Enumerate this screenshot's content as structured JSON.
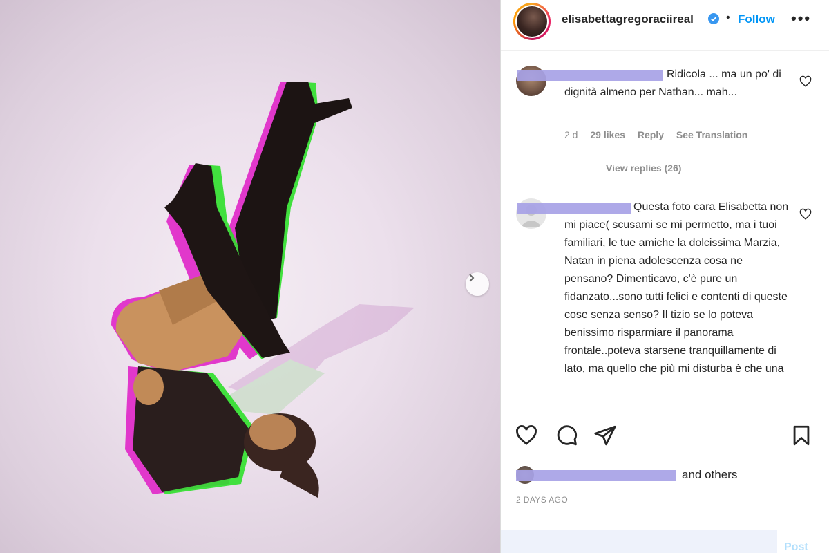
{
  "post": {
    "username": "elisabettagregoraciireal",
    "follow_label": "Follow",
    "more_label": "•••",
    "separator": "•"
  },
  "comments": [
    {
      "text": "Ridicola ... ma un po' di dignità almeno per Nathan... mah...",
      "age": "2 d",
      "likes": "29 likes",
      "reply_label": "Reply",
      "translate_label": "See Translation",
      "view_replies": "View replies (26)"
    },
    {
      "text": "Questa foto cara Elisabetta non mi piace( scusami se mi permetto, ma i tuoi familiari, le tue amiche la dolcissima Marzia, Natan in piena adolescenza cosa ne pensano? Dimenticavo, c'è pure un fidanzato...sono tutti felici e contenti di queste cose senza senso? Il tizio se lo poteva benissimo risparmiare il panorama frontale..poteva starsene tranquillamente di lato, ma quello che più mi disturba è che una"
    }
  ],
  "likes": {
    "suffix": "and others"
  },
  "date": "2 DAYS AGO",
  "add_comment": {
    "placeholder": "",
    "post_label": "Post"
  },
  "colors": {
    "accent": "#0095f6",
    "redaction": "#a7a2e6",
    "text": "#262626",
    "muted": "#8e8e8e"
  }
}
